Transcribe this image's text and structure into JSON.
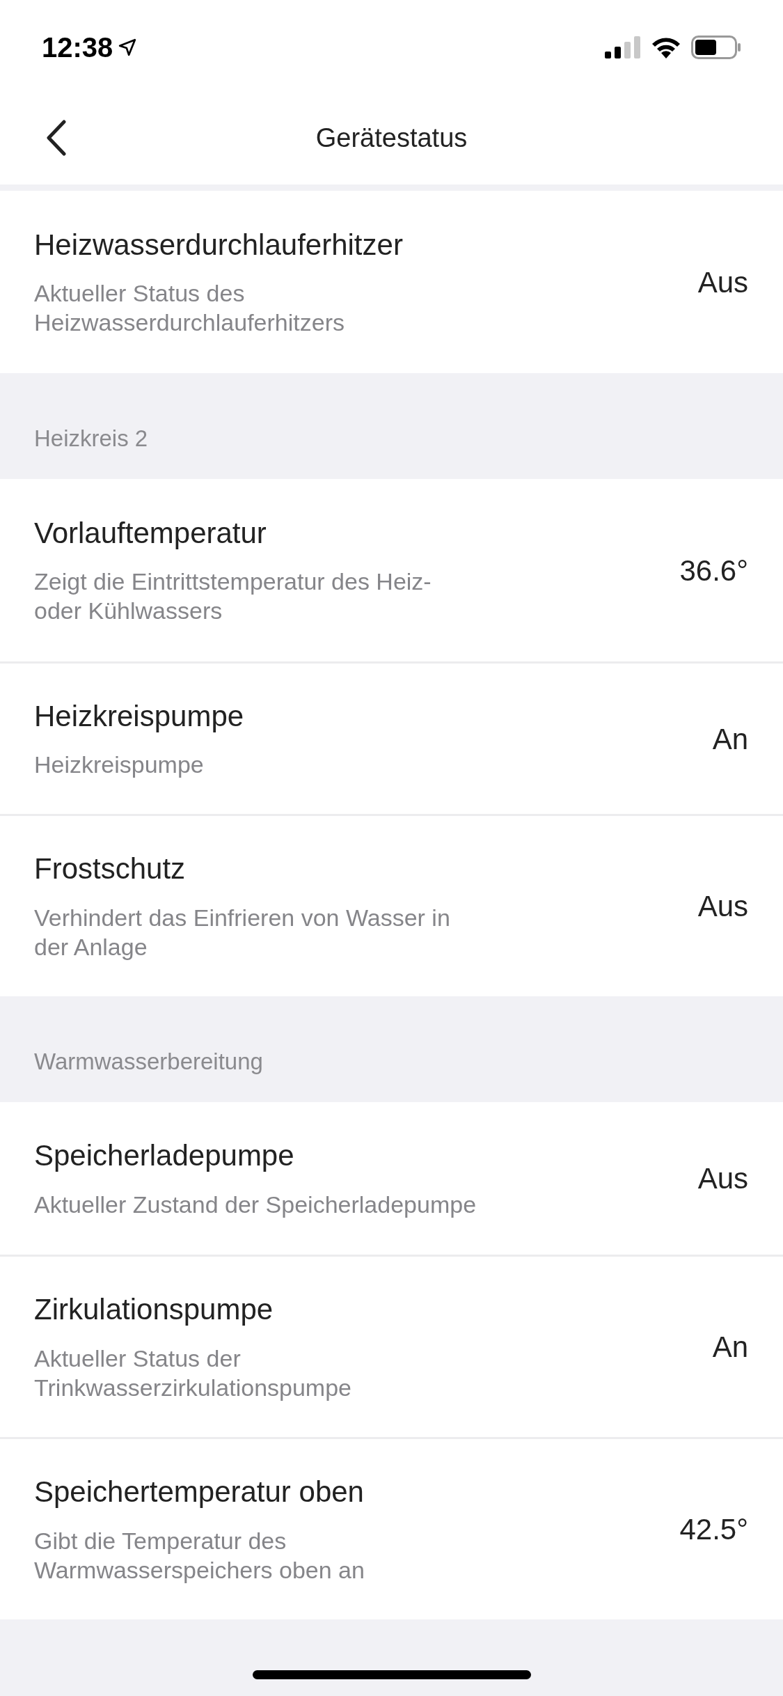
{
  "status_bar": {
    "time": "12:38"
  },
  "nav": {
    "title": "Gerätestatus"
  },
  "sections": [
    {
      "rows": [
        {
          "title": "Heizwasserdurchlauferhitzer",
          "subtitle": "Aktueller Status des\nHeizwasserdurchlauferhitzers",
          "value": "Aus"
        }
      ]
    },
    {
      "header": "Heizkreis 2",
      "rows": [
        {
          "title": "Vorlauftemperatur",
          "subtitle": "Zeigt die Eintrittstemperatur des Heiz-\noder Kühlwassers",
          "value": "36.6°"
        },
        {
          "title": "Heizkreispumpe",
          "subtitle": "Heizkreispumpe",
          "value": "An"
        },
        {
          "title": "Frostschutz",
          "subtitle": "Verhindert das Einfrieren von Wasser in\nder Anlage",
          "value": "Aus"
        }
      ]
    },
    {
      "header": "Warmwasserbereitung",
      "rows": [
        {
          "title": "Speicherladepumpe",
          "subtitle": "Aktueller Zustand der Speicherladepumpe",
          "value": "Aus"
        },
        {
          "title": "Zirkulationspumpe",
          "subtitle": "Aktueller Status der\nTrinkwasserzirkulationspumpe",
          "value": "An"
        },
        {
          "title": "Speichertemperatur oben",
          "subtitle": "Gibt die Temperatur des\nWarmwasserspeichers oben an",
          "value": "42.5°"
        }
      ]
    }
  ]
}
